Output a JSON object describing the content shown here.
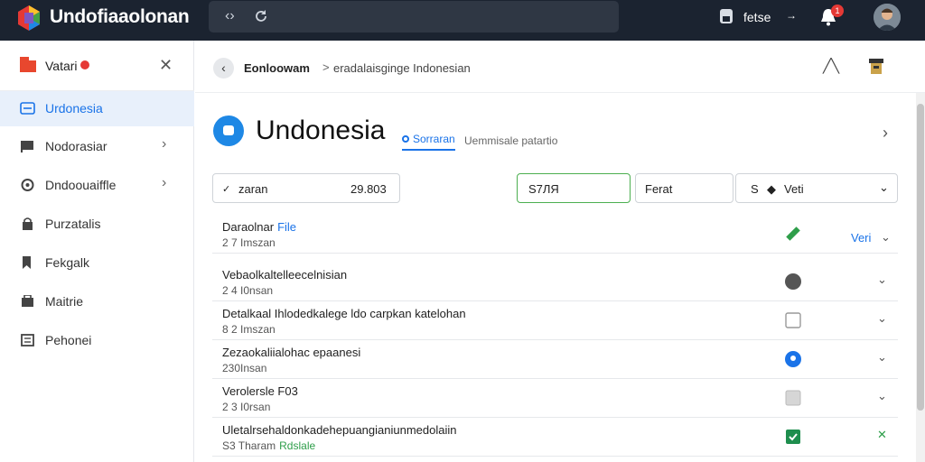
{
  "app": {
    "title": "Undofiaaolonan",
    "user_label": "fetse",
    "notification_count": "1"
  },
  "sidebar": {
    "header_label": "Vatari",
    "items": [
      {
        "label": "Urdonesia",
        "icon": "inbox-icon",
        "active": true,
        "has_chevron": false
      },
      {
        "label": "Nodorasiar",
        "icon": "flag-icon",
        "active": false,
        "has_chevron": true
      },
      {
        "label": "Dndoouaiffle",
        "icon": "gear-icon",
        "active": false,
        "has_chevron": true
      },
      {
        "label": "Purzatalis",
        "icon": "lock-icon",
        "active": false,
        "has_chevron": false
      },
      {
        "label": "Fekgalk",
        "icon": "bookmark-icon",
        "active": false,
        "has_chevron": false
      },
      {
        "label": "Maitrie",
        "icon": "tool-icon",
        "active": false,
        "has_chevron": false
      },
      {
        "label": "Pehonei",
        "icon": "document-icon",
        "active": false,
        "has_chevron": false
      }
    ]
  },
  "breadcrumb": {
    "first": "Eonloowam",
    "separator": ">",
    "second": "eradalaisginge Indonesian"
  },
  "page": {
    "title": "Undonesia",
    "tab": "Sorraran",
    "subtitle": "Uemmisale patartio"
  },
  "filters": {
    "filter1_label": "zaran",
    "filter1_value": "29.803",
    "filter2_value": "S7ЛЯ",
    "filter3_value": "Ferat",
    "filter4_prefix": "S",
    "filter4_value": "Veti"
  },
  "list": {
    "rows": [
      {
        "name": "Daraolnar",
        "name_highlight": "File",
        "meta": "2 7 Imszan",
        "meta_highlight": "",
        "status": "pencil-icon",
        "action": "Veri",
        "action_style": "blue"
      },
      {
        "name": "Vebaolkaltelleecelnisian",
        "name_highlight": "",
        "meta": "2 4 I0nsan",
        "meta_highlight": "",
        "status": "dark-dot",
        "action": "chevron",
        "action_style": ""
      },
      {
        "name": "Detalkaal Ihlodedkalege ldo carpkan katelohan",
        "name_highlight": "",
        "meta": "8 2 Imszan",
        "meta_highlight": "",
        "status": "empty-checkbox",
        "action": "chevron",
        "action_style": ""
      },
      {
        "name": "Zezaokaliialohac epaanesi",
        "name_highlight": "",
        "meta": "230Insan",
        "meta_highlight": "",
        "status": "blue-dot",
        "action": "chevron",
        "action_style": ""
      },
      {
        "name": "Verolersle F03",
        "name_highlight": "",
        "meta": "2 3 I0rsan",
        "meta_highlight": "",
        "status": "grey-checkbox",
        "action": "chevron",
        "action_style": ""
      },
      {
        "name": "Uletalrsehaldonkadehepuangianiunmedolaiin",
        "name_highlight": "",
        "meta": "S3 Tharam",
        "meta_highlight": "Rdslale",
        "status": "checked-checkbox",
        "action": "close",
        "action_style": "green"
      }
    ]
  },
  "colors": {
    "topbar": "#1b2330",
    "accent": "#1a73e8",
    "success": "#2e9e4a",
    "danger": "#e53935"
  }
}
